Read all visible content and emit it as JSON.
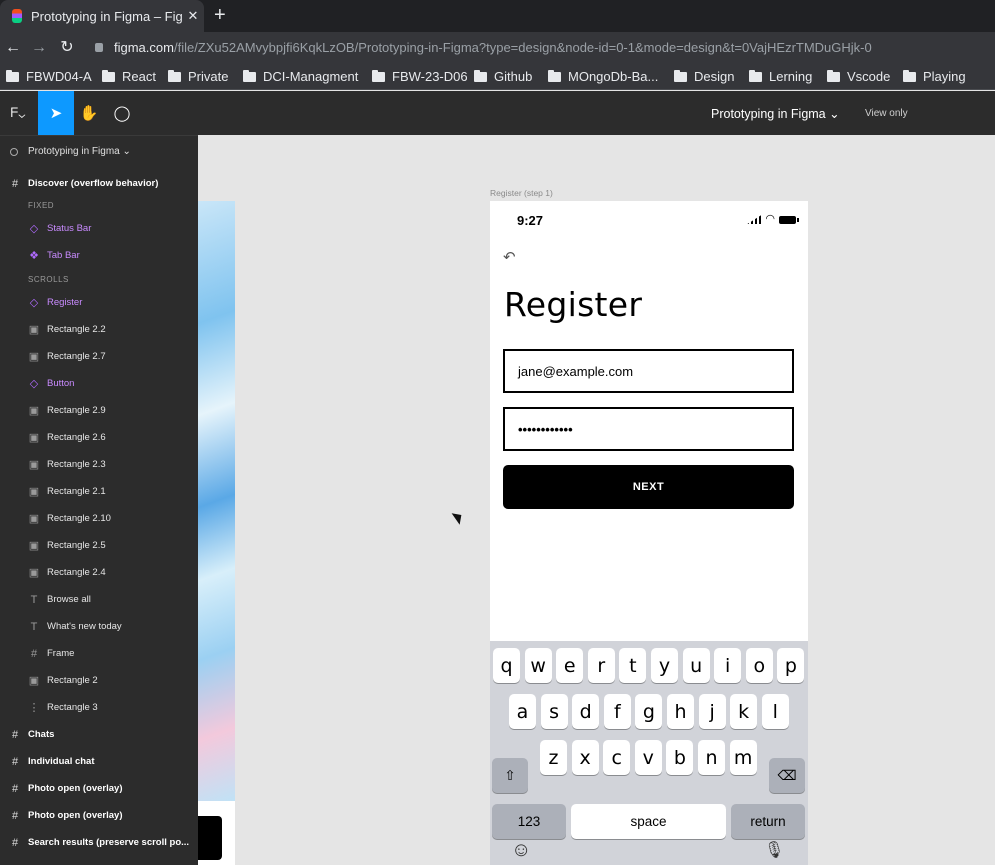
{
  "browser": {
    "tab_title": "Prototyping in Figma – Fig",
    "tab_close": "✕",
    "new_tab": "+",
    "url_host": "figma.com",
    "url_path": "/file/ZXu52AMvybpjfi6KqkLzOB/Prototyping-in-Figma?type=design&node-id=0-1&mode=design&t=0VajHEzrTMDuGHjk-0",
    "bookmarks": [
      "FBWD04-A",
      "React",
      "Private",
      "DCI-Managment",
      "FBW-23-D06",
      "Github",
      "MOngoDb-Ba...",
      "Design",
      "Lerning",
      "Vscode",
      "Playing"
    ]
  },
  "toolbar": {
    "file_title": "Prototyping in Figma",
    "view_only": "View only"
  },
  "sidebar": {
    "page_name": "Prototyping in Figma",
    "layers": [
      {
        "label": "Discover (overflow behavior)",
        "icon": "#"
      },
      {
        "label": "FIXED"
      },
      {
        "label": "Status Bar",
        "icon": "◇"
      },
      {
        "label": "Tab Bar",
        "icon": "❖"
      },
      {
        "label": "SCROLLS"
      },
      {
        "label": "Register",
        "icon": "◇"
      },
      {
        "label": "Rectangle 2.2",
        "icon": "▣"
      },
      {
        "label": "Rectangle 2.7",
        "icon": "▣"
      },
      {
        "label": "Button",
        "icon": "◇"
      },
      {
        "label": "Rectangle 2.9",
        "icon": "▣"
      },
      {
        "label": "Rectangle 2.6",
        "icon": "▣"
      },
      {
        "label": "Rectangle 2.3",
        "icon": "▣"
      },
      {
        "label": "Rectangle 2.1",
        "icon": "▣"
      },
      {
        "label": "Rectangle 2.10",
        "icon": "▣"
      },
      {
        "label": "Rectangle 2.5",
        "icon": "▣"
      },
      {
        "label": "Rectangle 2.4",
        "icon": "▣"
      },
      {
        "label": "Browse all",
        "icon": "T"
      },
      {
        "label": "What's new today",
        "icon": "T"
      },
      {
        "label": "Frame",
        "icon": "#"
      },
      {
        "label": "Rectangle 2",
        "icon": "▣"
      },
      {
        "label": "Rectangle 3",
        "icon": "⋮"
      },
      {
        "label": "Chats",
        "icon": "#"
      },
      {
        "label": "Individual chat",
        "icon": "#"
      },
      {
        "label": "Photo open (overlay)",
        "icon": "#"
      },
      {
        "label": "Photo open (overlay)",
        "icon": "#"
      },
      {
        "label": "Search results (preserve scroll po...",
        "icon": "#"
      }
    ]
  },
  "canvas": {
    "frame_label": "Register (step 1)",
    "phone": {
      "time": "9:27",
      "back_icon": "↶",
      "heading": "Register",
      "email_value": "jane@example.com",
      "password_value": "••••••••••••",
      "next_label": "NEXT",
      "keyboard": {
        "row1": [
          "q",
          "w",
          "e",
          "r",
          "t",
          "y",
          "u",
          "i",
          "o",
          "p"
        ],
        "row2": [
          "a",
          "s",
          "d",
          "f",
          "g",
          "h",
          "j",
          "k",
          "l"
        ],
        "row3": [
          "z",
          "x",
          "c",
          "v",
          "b",
          "n",
          "m"
        ],
        "shift": "⇧",
        "delete": "⌫",
        "numbers": "123",
        "space": "space",
        "return": "return",
        "emoji": "☺",
        "mic": "🎙"
      }
    }
  }
}
